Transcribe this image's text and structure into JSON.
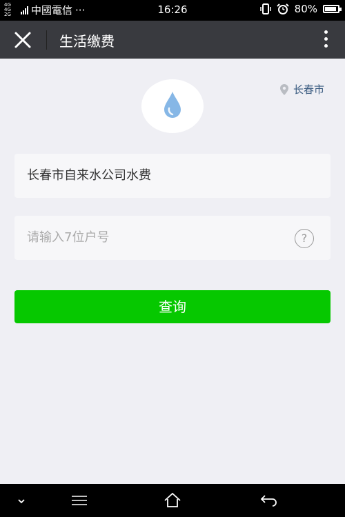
{
  "status_bar": {
    "network": "4G 4G 2G",
    "carrier": "中國電信",
    "dots": "···",
    "time": "16:26",
    "battery": "80%",
    "battery_level": 0.8,
    "icons": [
      "signal-bars-icon",
      "vibrate-icon",
      "alarm-clock-icon",
      "battery-icon"
    ]
  },
  "header": {
    "title": "生活缴费",
    "icons": [
      "close-icon",
      "more-vertical-icon"
    ]
  },
  "main": {
    "location": "长春市",
    "icons": [
      "water-drop-icon",
      "location-pin-icon",
      "question-icon"
    ],
    "company_name": "长春市自来水公司水费",
    "account_placeholder": "请输入7位户号",
    "help_symbol": "?",
    "query_button": "查询"
  },
  "colors": {
    "nav_bg": "#393a3f",
    "page_bg": "#efeff4",
    "primary_green": "#06c800",
    "location_text": "#3a5b80",
    "water_drop": "#86b7e6"
  },
  "system_nav": {
    "icons": [
      "chevron-down-icon",
      "menu-icon",
      "home-icon",
      "back-icon"
    ]
  }
}
